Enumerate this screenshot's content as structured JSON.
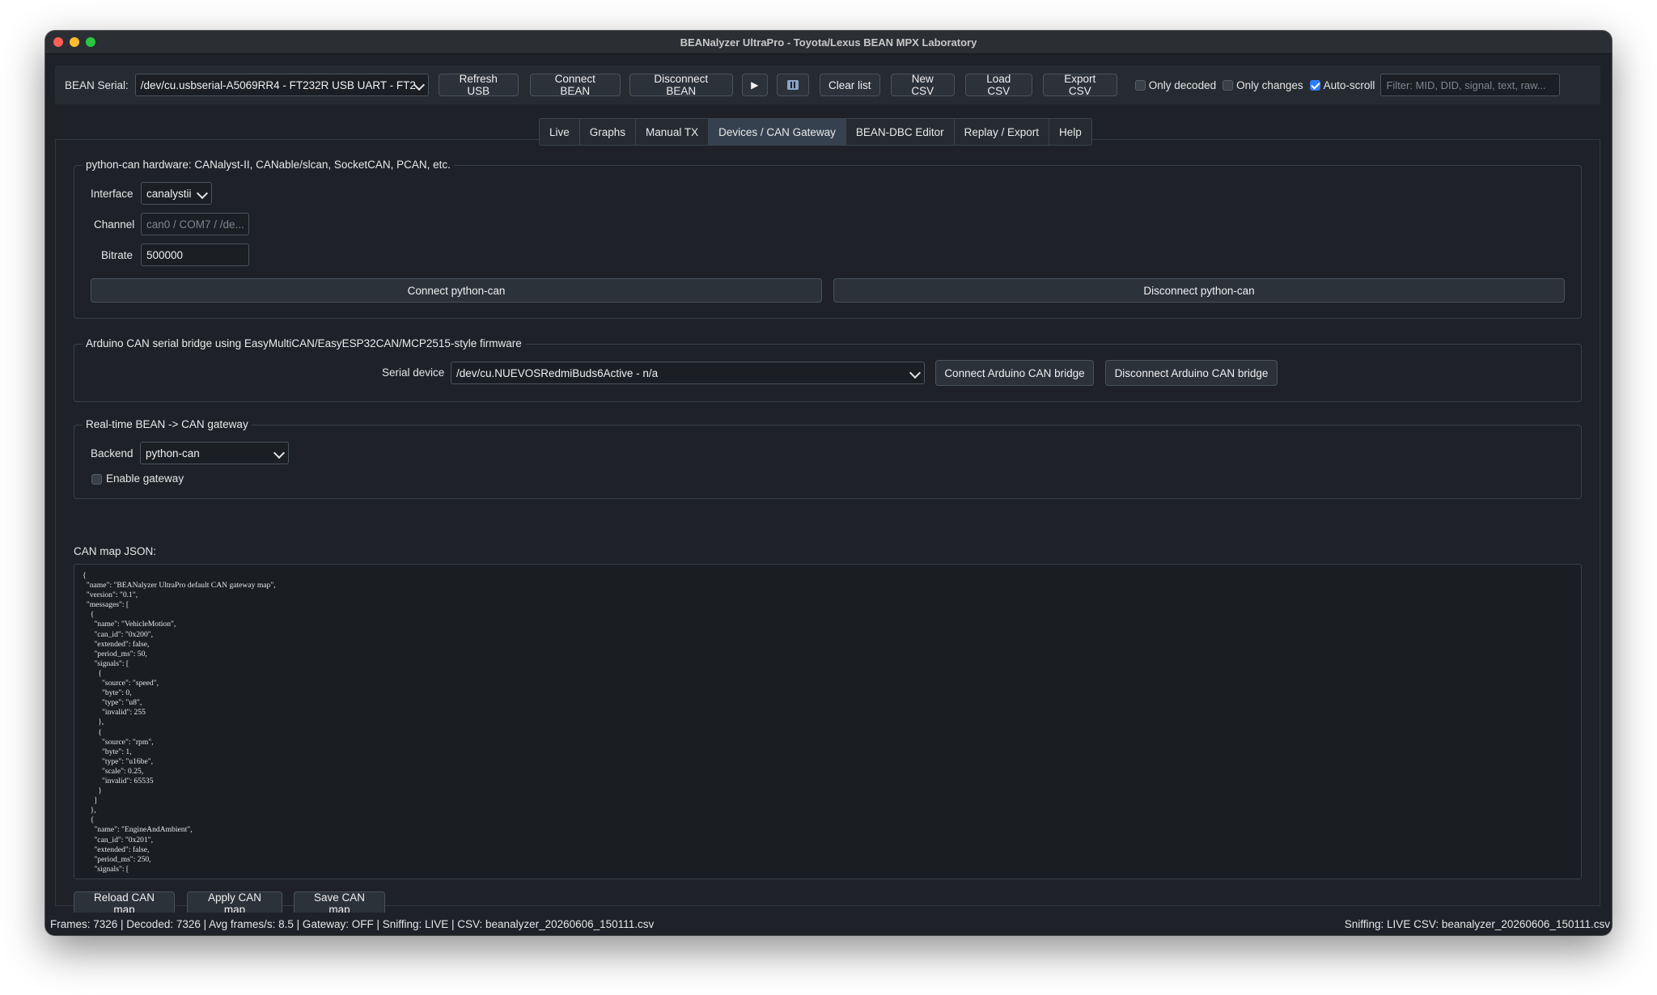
{
  "window": {
    "title": "BEANalyzer UltraPro - Toyota/Lexus BEAN MPX Laboratory"
  },
  "toolbar": {
    "serial_label": "BEAN Serial:",
    "serial_value": "/dev/cu.usbserial-A5069RR4 - FT232R USB UART - FT2",
    "refresh_usb": "Refresh USB",
    "connect_bean": "Connect BEAN",
    "disconnect_bean": "Disconnect BEAN",
    "play_glyph": "▶",
    "pause_glyph": "⏸",
    "clear_list": "Clear list",
    "new_csv": "New CSV",
    "load_csv": "Load CSV",
    "export_csv": "Export CSV",
    "only_decoded": "Only decoded",
    "only_changes": "Only changes",
    "auto_scroll": "Auto-scroll",
    "filter_placeholder": "Filter: MID, DID, signal, text, raw..."
  },
  "tabs": [
    {
      "label": "Live"
    },
    {
      "label": "Graphs"
    },
    {
      "label": "Manual TX"
    },
    {
      "label": "Devices / CAN Gateway"
    },
    {
      "label": "BEAN-DBC Editor"
    },
    {
      "label": "Replay / Export"
    },
    {
      "label": "Help"
    }
  ],
  "python_can": {
    "title": "python-can hardware: CANalyst-II, CANable/slcan, SocketCAN, PCAN, etc.",
    "interface_label": "Interface",
    "interface_value": "canalystii",
    "channel_label": "Channel",
    "channel_placeholder": "can0 / COM7 / /de...",
    "bitrate_label": "Bitrate",
    "bitrate_value": "500000",
    "connect": "Connect python-can",
    "disconnect": "Disconnect python-can"
  },
  "arduino": {
    "title": "Arduino CAN serial bridge using EasyMultiCAN/EasyESP32CAN/MCP2515-style firmware",
    "device_label": "Serial device",
    "device_value": "/dev/cu.NUEVOSRedmiBuds6Active - n/a",
    "connect": "Connect Arduino CAN bridge",
    "disconnect": "Disconnect Arduino CAN bridge"
  },
  "gateway": {
    "title": "Real-time BEAN -> CAN gateway",
    "backend_label": "Backend",
    "backend_value": "python-can",
    "enable_label": "Enable gateway"
  },
  "canmap": {
    "label": "CAN map JSON:",
    "json_text": "{\n  \"name\": \"BEANalyzer UltraPro default CAN gateway map\",\n  \"version\": \"0.1\",\n  \"messages\": [\n    {\n      \"name\": \"VehicleMotion\",\n      \"can_id\": \"0x200\",\n      \"extended\": false,\n      \"period_ms\": 50,\n      \"signals\": [\n        {\n          \"source\": \"speed\",\n          \"byte\": 0,\n          \"type\": \"u8\",\n          \"invalid\": 255\n        },\n        {\n          \"source\": \"rpm\",\n          \"byte\": 1,\n          \"type\": \"u16be\",\n          \"scale\": 0.25,\n          \"invalid\": 65535\n        }\n      ]\n    },\n    {\n      \"name\": \"EngineAndAmbient\",\n      \"can_id\": \"0x201\",\n      \"extended\": false,\n      \"period_ms\": 250,\n      \"signals\": [",
    "reload": "Reload CAN map",
    "apply": "Apply CAN map",
    "save": "Save CAN map"
  },
  "status": {
    "left": "Frames: 7326 | Decoded: 7326 | Avg frames/s: 8.5 | Gateway: OFF | Sniffing: LIVE | CSV: beanalyzer_20260606_150111.csv",
    "right": "Sniffing: LIVE  CSV: beanalyzer_20260606_150111.csv"
  }
}
